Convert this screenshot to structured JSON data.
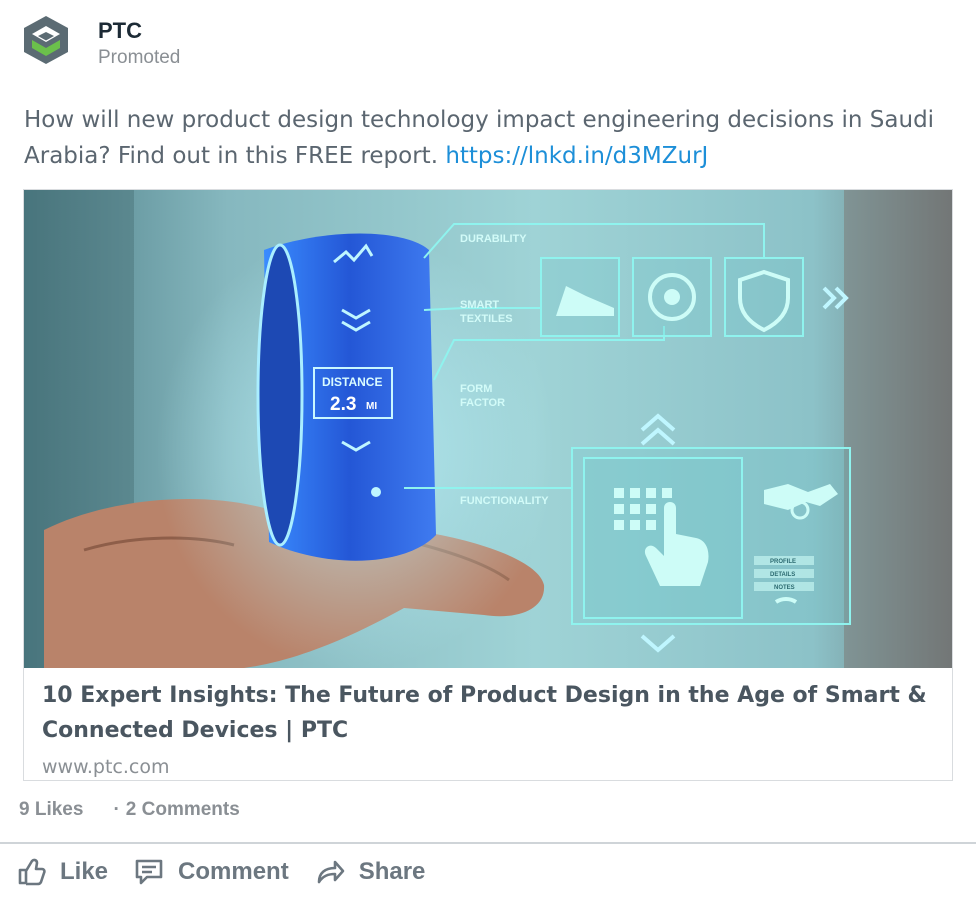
{
  "post": {
    "company_name": "PTC",
    "promoted_label": "Promoted",
    "text": "How will new product design technology impact engineering decisions in Saudi Arabia? Find out in this FREE report. ",
    "link": "https://lnkd.in/d3MZurJ"
  },
  "card": {
    "title": "10 Expert Insights: The Future of Product Design in the Age of Smart & Connected Devices | PTC",
    "domain": "www.ptc.com",
    "image": {
      "labels": {
        "durability": "DURABILITY",
        "smart": "SMART",
        "textiles": "TEXTILES",
        "form": "FORM",
        "factor": "FACTOR",
        "functionality": "FUNCTIONALITY",
        "distance": "DISTANCE",
        "distance_value": "2.3",
        "distance_unit": "MI",
        "profile": "PROFILE",
        "details": "DETAILS",
        "notes": "NOTES"
      }
    }
  },
  "social": {
    "likes": "9 Likes",
    "separator": "·",
    "comments": "2 Comments"
  },
  "actions": {
    "like": "Like",
    "comment": "Comment",
    "share": "Share"
  },
  "colors": {
    "link": "#1d8fd8",
    "logo_green": "#6bc04b",
    "logo_gray": "#5b6b73",
    "holo_cyan": "#7ef0ea",
    "band_blue": "#2f6ff0"
  }
}
